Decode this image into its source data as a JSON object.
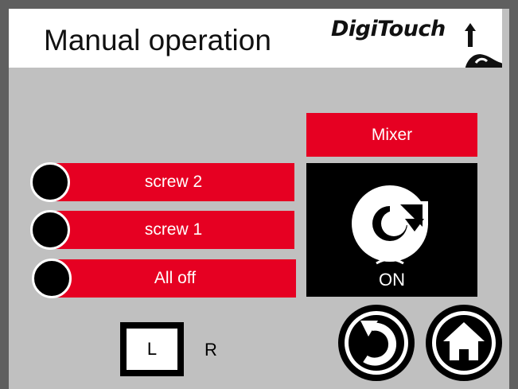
{
  "header": {
    "title": "Manual operation",
    "logo_text": "DigiTouch"
  },
  "buttons": {
    "mixer": "Mixer",
    "screw2": "screw 2",
    "screw1": "screw 1",
    "all_off": "All off"
  },
  "mixer_panel": {
    "icon": "rotate-icon",
    "status": "ON"
  },
  "direction": {
    "left": "L",
    "right": "R"
  },
  "nav": {
    "back_icon": "back-arrow-icon",
    "home_icon": "home-icon"
  },
  "colors": {
    "accent_red": "#e60022",
    "background": "#c0c0c0",
    "frame": "#5f5f5f"
  }
}
